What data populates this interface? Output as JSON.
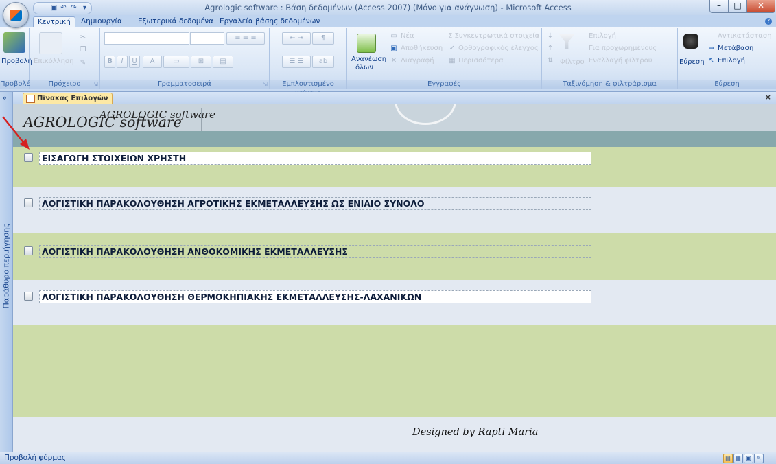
{
  "window": {
    "title": "Agrologic software : Βάση δεδομένων (Access 2007) (Μόνο για ανάγνωση) - Microsoft Access",
    "office_button_icon": "office-logo-icon",
    "quick_access": [
      "save-icon",
      "undo-icon",
      "redo-icon",
      "customize-icon"
    ],
    "controls": [
      "minimize-icon",
      "maximize-icon",
      "close-icon"
    ]
  },
  "tabs": [
    {
      "label": "Κεντρική",
      "active": true
    },
    {
      "label": "Δημιουργία",
      "active": false
    },
    {
      "label": "Εξωτερικά δεδομένα",
      "active": false
    },
    {
      "label": "Εργαλεία βάσης δεδομένων",
      "active": false
    }
  ],
  "ribbon": {
    "views": {
      "group": "Προβολές",
      "button": "Προβολή"
    },
    "clipboard": {
      "group": "Πρόχειρο",
      "paste": "Επικόλληση"
    },
    "font": {
      "group": "Γραμματοσειρά",
      "bold": "B",
      "italic": "I",
      "underline": "U",
      "fontcolor": "A"
    },
    "richtext": {
      "group": "Εμπλουτισμένο κείμενο"
    },
    "records": {
      "group": "Εγγραφές",
      "refresh": "Ανανέωση",
      "refresh2": "όλων",
      "new": "Νέα",
      "save": "Αποθήκευση",
      "delete": "Διαγραφή",
      "totals": "Σ  Συγκεντρωτικά στοιχεία",
      "spelling": "Ορθογραφικός έλεγχος",
      "more": "Περισσότερα"
    },
    "sort": {
      "group": "Ταξινόμηση & φιλτράρισμα",
      "filter": "Φίλτρο",
      "selection": "Επιλογή",
      "advanced": "Για προχωρημένους",
      "toggle": "Εναλλαγή φίλτρου"
    },
    "find": {
      "group": "Εύρεση",
      "find": "Εύρεση",
      "replace": "Αντικατάσταση",
      "goto": "Μετάβαση",
      "select": "Επιλογή"
    }
  },
  "navpane": {
    "label": "Παράθυρο περιήγησης",
    "chevron": "»"
  },
  "doc_tab": {
    "label": "Πίνακας Επιλογών",
    "close": "×"
  },
  "form": {
    "title_small": "AGROLOGIC software",
    "title_big": "AGROLOGIC  software",
    "options": [
      "ΕΙΣΑΓΩΓΗ ΣΤΟΙΧΕΙΩΝ ΧΡΗΣΤΗ",
      "ΛΟΓΙΣΤΙΚΗ ΠΑΡΑΚΟΛΟΥΘΗΣΗ ΑΓΡΟΤΙΚΗΣ ΕΚΜΕΤΑΛΛΕΥΣΗΣ ΩΣ ΕΝΙΑΙΟ ΣΥΝΟΛΟ",
      "ΛΟΓΙΣΤΙΚΗ ΠΑΡΑΚΟΛΟΥΘΗΣΗ ΑΝΘΟΚΟΜΙΚΗΣ ΕΚΜΕΤΑΛΛΕΥΣΗΣ",
      "ΛΟΓΙΣΤΙΚΗ ΠΑΡΑΚΟΛΟΥΘΗΣΗ ΘΕΡΜΟΚΗΠΙΑΚΗΣ ΕΚΜΕΤΑΛΛΕΥΣΗΣ-ΛΑΧΑΝΙΚΩΝ"
    ],
    "footer": "Designed by Rapti Maria"
  },
  "statusbar": {
    "text": "Προβολή φόρμας",
    "views": [
      "form-view-icon",
      "datasheet-view-icon",
      "layout-view-icon",
      "design-view-icon"
    ]
  },
  "colors": {
    "accent": "#15428b",
    "form_green": "#cddca9",
    "form_header": "#87a8ac",
    "annotation_arrow": "#d62020"
  }
}
